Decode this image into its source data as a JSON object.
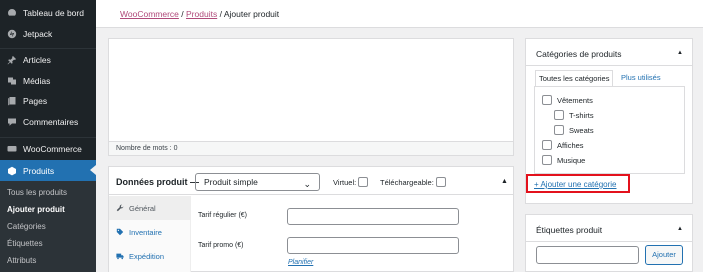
{
  "sidebar": {
    "items": [
      {
        "label": "Tableau de bord",
        "icon": "dashboard-icon"
      },
      {
        "label": "Jetpack",
        "icon": "jetpack-icon"
      },
      {
        "label": "Articles",
        "icon": "pin-icon"
      },
      {
        "label": "Médias",
        "icon": "media-icon"
      },
      {
        "label": "Pages",
        "icon": "page-icon"
      },
      {
        "label": "Commentaires",
        "icon": "comment-icon"
      },
      {
        "label": "WooCommerce",
        "icon": "woocommerce-icon"
      },
      {
        "label": "Produits",
        "icon": "product-box-icon"
      }
    ],
    "submenu": [
      "Tous les produits",
      "Ajouter produit",
      "Catégories",
      "Étiquettes",
      "Attributs"
    ],
    "active_color": "#2271b1"
  },
  "breadcrumb": {
    "woocommerce": "WooCommerce",
    "produits": "Produits",
    "sep": "/",
    "current": "Ajouter produit"
  },
  "editor": {
    "word_count": "Nombre de mots : 0"
  },
  "product_data": {
    "title": "Données produit —",
    "type_value": "Produit simple",
    "virtual_label": "Virtuel:",
    "downloadable_label": "Téléchargeable:",
    "tabs": [
      {
        "label": "Général",
        "icon": "wrench-icon"
      },
      {
        "label": "Inventaire",
        "icon": "tag-icon"
      },
      {
        "label": "Expédition",
        "icon": "truck-icon"
      }
    ],
    "regular_price_label": "Tarif régulier (€)",
    "sale_price_label": "Tarif promo (€)",
    "schedule_link": "Planifier"
  },
  "categories": {
    "title": "Catégories de produits",
    "tab_all": "Toutes les catégories",
    "tab_popular": "Plus utilisés",
    "items": [
      "Vêtements",
      "T-shirts",
      "Sweats",
      "Affiches",
      "Musique"
    ],
    "add_link": "+ Ajouter une catégorie",
    "highlight_color": "#e3111c"
  },
  "tags": {
    "title": "Étiquettes produit",
    "add_button": "Ajouter"
  }
}
